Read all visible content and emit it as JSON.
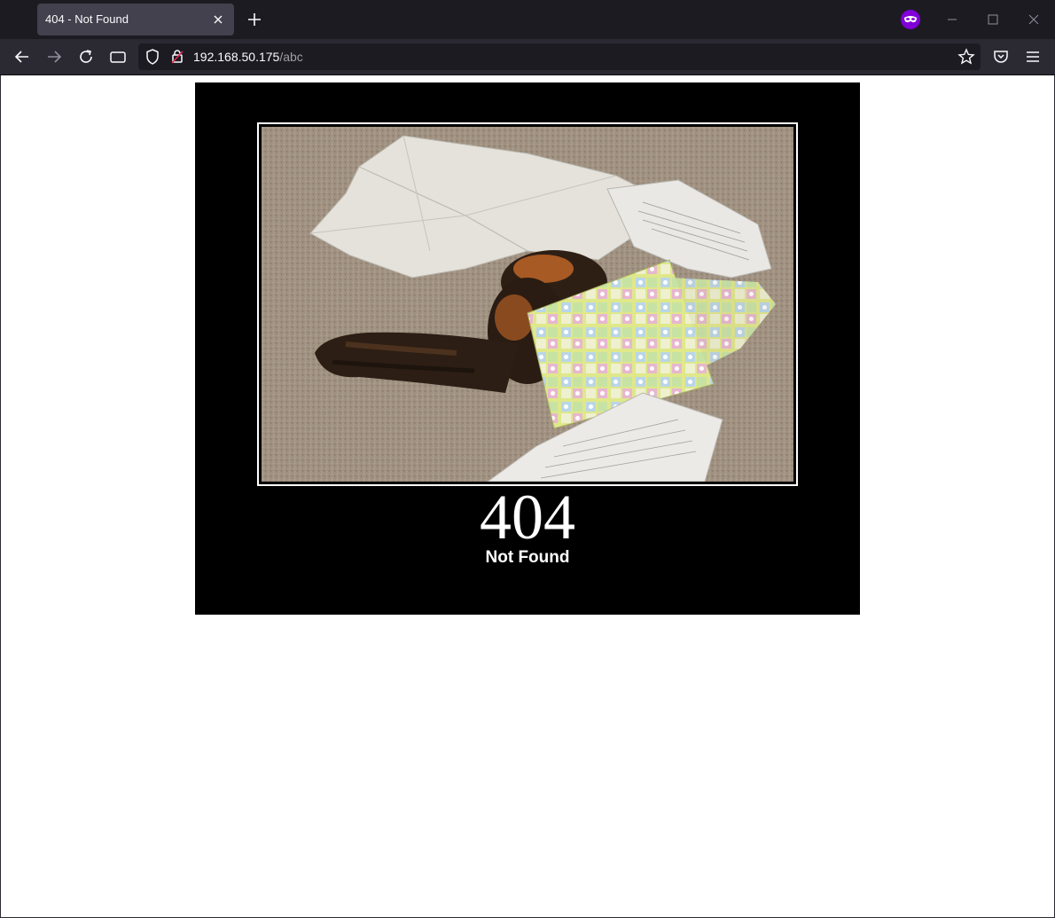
{
  "browser": {
    "tab": {
      "title": "404 - Not Found"
    },
    "address": {
      "host": "192.168.50.175",
      "path": "/abc"
    }
  },
  "page": {
    "code": "404",
    "message": "Not Found"
  },
  "colors": {
    "tabstrip": "#1c1b22",
    "toolbar": "#2b2a33",
    "private_accent": "#8000d7",
    "poster_bg": "#000000"
  }
}
